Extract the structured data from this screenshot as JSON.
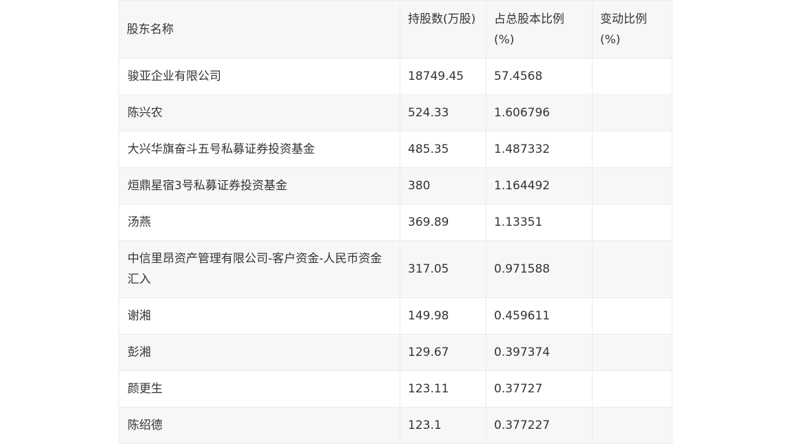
{
  "table": {
    "headers": [
      "股东名称",
      "持股数(万股)",
      "占总股本比例(%)",
      "变动比例(%)"
    ],
    "rows": [
      [
        "骏亚企业有限公司",
        "18749.45",
        "57.4568",
        ""
      ],
      [
        "陈兴农",
        "524.33",
        "1.606796",
        ""
      ],
      [
        "大兴华旗奋斗五号私募证券投资基金",
        "485.35",
        "1.487332",
        ""
      ],
      [
        "烜鼎星宿3号私募证券投资基金",
        "380",
        "1.164492",
        ""
      ],
      [
        "汤燕",
        "369.89",
        "1.13351",
        ""
      ],
      [
        "中信里昂资产管理有限公司-客户资金-人民币资金汇入",
        "317.05",
        "0.971588",
        ""
      ],
      [
        "谢湘",
        "149.98",
        "0.459611",
        ""
      ],
      [
        "彭湘",
        "129.67",
        "0.397374",
        ""
      ],
      [
        "颜更生",
        "123.11",
        "0.37727",
        ""
      ],
      [
        "陈绍德",
        "123.1",
        "0.377227",
        ""
      ]
    ]
  }
}
